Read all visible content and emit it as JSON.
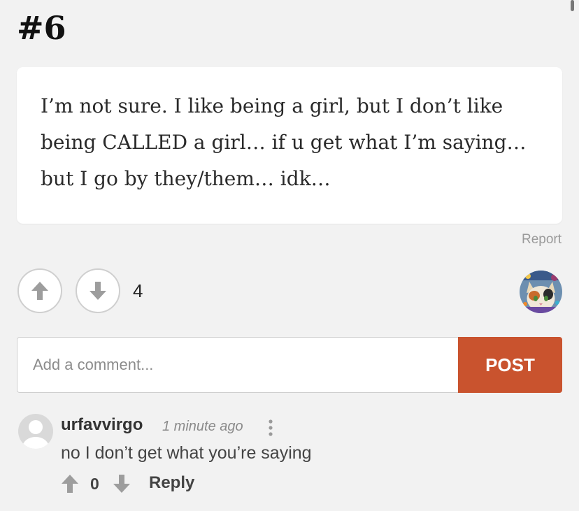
{
  "entry": {
    "number": "#6",
    "text": "I’m not sure. I like being a girl, but I don’t like being CALLED a girl… if u get what I’m saying… but I go by they/them… idk…",
    "report_label": "Report",
    "vote_count": "4",
    "upvote_icon": "arrow-up-icon",
    "downvote_icon": "arrow-down-icon",
    "author_avatar_icon": "cat-avatar-icon"
  },
  "comment_form": {
    "placeholder": "Add a comment...",
    "post_label": "POST"
  },
  "comments": [
    {
      "username": "urfavvirgo",
      "time": "1 minute ago",
      "text": "no I don’t get what you’re saying",
      "votes": "0",
      "reply_label": "Reply",
      "menu_icon": "more-vertical-icon",
      "avatar_icon": "default-user-avatar-icon"
    }
  ],
  "colors": {
    "accent": "#c9532e",
    "background": "#f2f2f2",
    "card": "#ffffff"
  }
}
